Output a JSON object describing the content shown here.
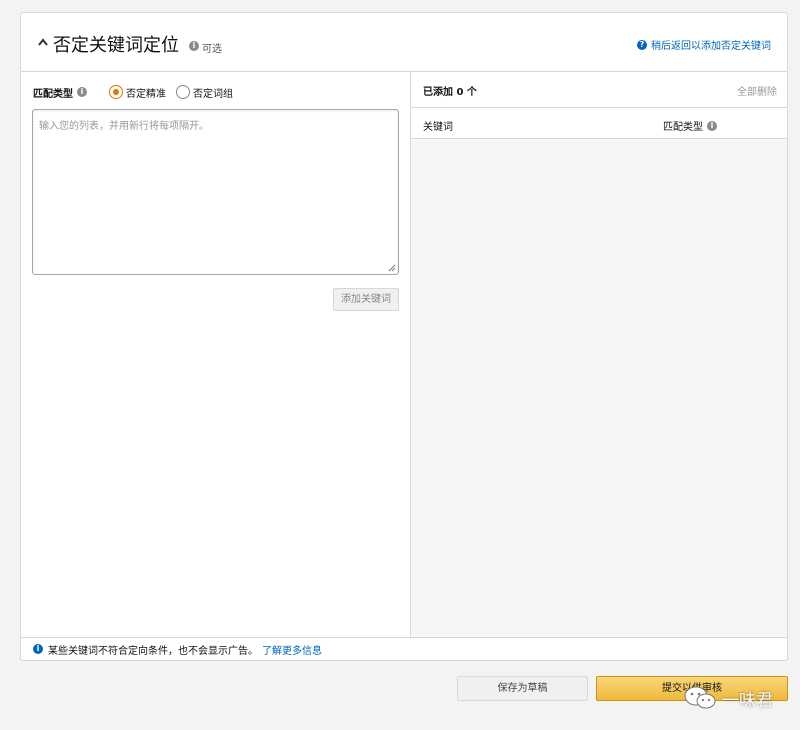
{
  "header": {
    "title": "否定关键词定位",
    "optional": "可选",
    "help_link": "稍后返回以添加否定关键词"
  },
  "left": {
    "match_type_label": "匹配类型",
    "radio_options": [
      {
        "label": "否定精准",
        "checked": true
      },
      {
        "label": "否定词组",
        "checked": false
      }
    ],
    "textarea_placeholder": "输入您的列表，并用新行将每项隔开。",
    "add_button": "添加关键词"
  },
  "right": {
    "added_count": "已添加 0 个",
    "delete_all": "全部删除",
    "columns": [
      "关键词",
      "匹配类型"
    ]
  },
  "footer": {
    "notice": "某些关键词不符合定向条件，也不会显示广告。",
    "learn_more": "了解更多信息"
  },
  "actions": {
    "save_draft": "保存为草稿",
    "submit": "提交以供审核"
  },
  "watermark": {
    "text": "一味君"
  },
  "colors": {
    "accent_link": "#0066c0",
    "radio_checked": "#e77600",
    "submit_button": "#f0b93b"
  },
  "icons": [
    "chevron-up-icon",
    "info-icon",
    "help-icon",
    "wechat-icon"
  ]
}
